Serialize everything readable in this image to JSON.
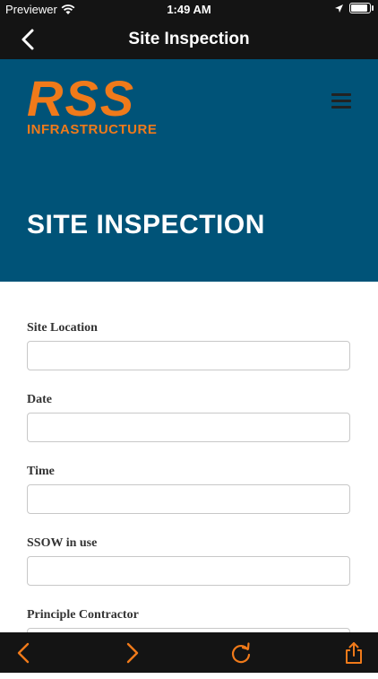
{
  "status_bar": {
    "carrier": "Previewer",
    "time": "1:49 AM"
  },
  "nav": {
    "title": "Site Inspection",
    "back_icon": "chevron-left-icon"
  },
  "hero": {
    "logo_main": "RSS",
    "logo_sub": "INFRASTRUCTURE",
    "title": "SITE INSPECTION",
    "background_color": "#005378",
    "logo_color": "#f07a1a"
  },
  "form": {
    "fields": [
      {
        "label": "Site Location",
        "value": ""
      },
      {
        "label": "Date",
        "value": ""
      },
      {
        "label": "Time",
        "value": ""
      },
      {
        "label": "SSOW in use",
        "value": ""
      },
      {
        "label": "Principle Contractor",
        "value": ""
      }
    ]
  },
  "toolbar": {
    "icons": [
      "back-arrow-icon",
      "forward-arrow-icon",
      "reload-icon",
      "share-icon"
    ],
    "accent_color": "#f07a1a"
  }
}
